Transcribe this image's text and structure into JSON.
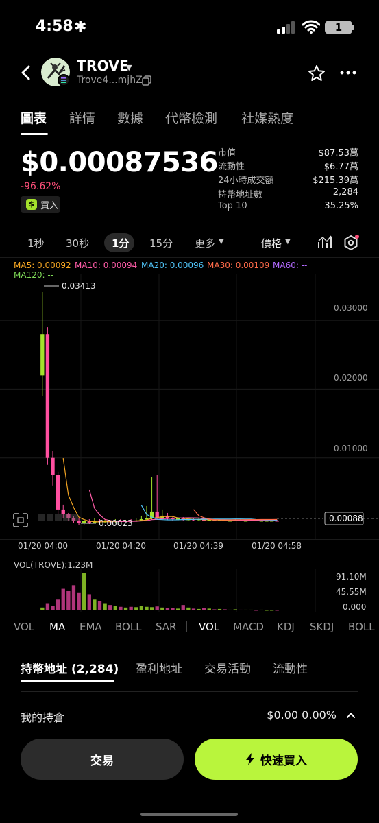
{
  "status": {
    "time": "4:58",
    "battery": "1"
  },
  "header": {
    "name": "TROVE",
    "address": "Trove4...mjhZ"
  },
  "tabs": [
    "圖表",
    "詳情",
    "數據",
    "代幣檢測",
    "社媒熱度"
  ],
  "price": {
    "value": "$0.00087536",
    "change": "-96.62%",
    "buy_label": "買入"
  },
  "stats": [
    {
      "label": "市值",
      "value": "$87.53萬"
    },
    {
      "label": "流動性",
      "value": "$6.77萬"
    },
    {
      "label": "24小時成交額",
      "value": "$215.39萬"
    },
    {
      "label": "持幣地址數",
      "value": "2,284"
    },
    {
      "label": "Top 10",
      "value": "35.25%"
    }
  ],
  "intervals": [
    "1秒",
    "30秒",
    "1分",
    "15分",
    "更多"
  ],
  "price_selector": "價格",
  "ma_legend": [
    {
      "label": "MA5: 0.00092",
      "color": "#f5a623"
    },
    {
      "label": "MA10: 0.00094",
      "color": "#ff5ca8"
    },
    {
      "label": "MA20: 0.00096",
      "color": "#4fc3f7"
    },
    {
      "label": "MA30: 0.00109",
      "color": "#ff6b4a"
    },
    {
      "label": "MA60: --",
      "color": "#b36bff"
    },
    {
      "label": "MA120: --",
      "color": "#7ed957"
    }
  ],
  "colors": {
    "up": "#a4e22c",
    "down": "#ff4fa0",
    "accent": "#b9f53c"
  },
  "chart_data": {
    "type": "candlestick",
    "y_ticks": [
      "0.03000",
      "0.02000",
      "0.01000"
    ],
    "x_ticks": [
      "01/20 04:00",
      "01/20 04:20",
      "01/20 04:39",
      "01/20 04:58"
    ],
    "high_label": "0.03413",
    "low_label": "0.00023",
    "last_price": "0.00088",
    "ylim": [
      0,
      0.035
    ],
    "candles": [
      [
        0.022,
        0.028,
        0.0341,
        0.019
      ],
      [
        0.028,
        0.01,
        0.029,
        0.009
      ],
      [
        0.01,
        0.0075,
        0.011,
        0.006
      ],
      [
        0.0075,
        0.0025,
        0.008,
        0.0018
      ],
      [
        0.0025,
        0.0018,
        0.0032,
        0.0012
      ],
      [
        0.0018,
        0.0012,
        0.002,
        0.0008
      ],
      [
        0.0012,
        0.0009,
        0.0015,
        0.0006
      ],
      [
        0.0009,
        0.0005,
        0.0012,
        0.0003
      ],
      [
        0.0005,
        0.0008,
        0.001,
        0.00023
      ],
      [
        0.0008,
        0.0006,
        0.0011,
        0.0004
      ],
      [
        0.0006,
        0.0009,
        0.0012,
        0.0005
      ],
      [
        0.0009,
        0.0007,
        0.0011,
        0.0005
      ],
      [
        0.0007,
        0.0008,
        0.001,
        0.0005
      ],
      [
        0.0008,
        0.0007,
        0.001,
        0.0006
      ],
      [
        0.0007,
        0.0009,
        0.0011,
        0.0006
      ],
      [
        0.0009,
        0.0008,
        0.0011,
        0.0007
      ],
      [
        0.0008,
        0.0009,
        0.001,
        0.0007
      ],
      [
        0.0009,
        0.0008,
        0.0011,
        0.0007
      ],
      [
        0.0008,
        0.0009,
        0.0012,
        0.0007
      ],
      [
        0.0009,
        0.0011,
        0.0016,
        0.0008
      ],
      [
        0.0011,
        0.0012,
        0.003,
        0.0009
      ],
      [
        0.0012,
        0.0022,
        0.0072,
        0.001
      ],
      [
        0.0022,
        0.0012,
        0.0075,
        0.001
      ],
      [
        0.0012,
        0.0016,
        0.0025,
        0.001
      ],
      [
        0.0016,
        0.0013,
        0.002,
        0.001
      ],
      [
        0.0013,
        0.0011,
        0.0016,
        0.0009
      ],
      [
        0.0011,
        0.0012,
        0.0014,
        0.0009
      ],
      [
        0.0012,
        0.001,
        0.0014,
        0.0009
      ],
      [
        0.001,
        0.0011,
        0.0013,
        0.0009
      ],
      [
        0.0011,
        0.001,
        0.0012,
        0.0009
      ],
      [
        0.001,
        0.0011,
        0.0012,
        0.0009
      ],
      [
        0.0011,
        0.0009,
        0.0012,
        0.0008
      ],
      [
        0.0009,
        0.001,
        0.0011,
        0.0008
      ],
      [
        0.001,
        0.0009,
        0.0011,
        0.0008
      ],
      [
        0.0009,
        0.001,
        0.0011,
        0.0008
      ],
      [
        0.001,
        0.0009,
        0.0011,
        0.0008
      ],
      [
        0.0009,
        0.0009,
        0.001,
        0.0008
      ],
      [
        0.0009,
        0.001,
        0.0011,
        0.0008
      ],
      [
        0.001,
        0.0009,
        0.0011,
        0.0008
      ],
      [
        0.0009,
        0.0009,
        0.001,
        0.0008
      ],
      [
        0.0009,
        0.001,
        0.0011,
        0.0008
      ],
      [
        0.001,
        0.0009,
        0.001,
        0.0008
      ],
      [
        0.0009,
        0.0009,
        0.001,
        0.0008
      ],
      [
        0.0009,
        0.0009,
        0.001,
        0.0008
      ],
      [
        0.0009,
        0.0009,
        0.001,
        0.0008
      ],
      [
        0.0009,
        0.00088,
        0.001,
        0.0008
      ]
    ]
  },
  "volume": {
    "title": "VOL(TROVE):1.23M",
    "y_ticks": [
      "91.10M",
      "45.55M",
      "0.000"
    ],
    "values": [
      8,
      20,
      12,
      30,
      60,
      55,
      70,
      50,
      105,
      45,
      30,
      25,
      20,
      15,
      12,
      10,
      8,
      10,
      9,
      12,
      10,
      9,
      11,
      8,
      6,
      7,
      5,
      15,
      8,
      5,
      4,
      6,
      5,
      3,
      4,
      3,
      2,
      3,
      2,
      2,
      2,
      1,
      2,
      1,
      1,
      1
    ]
  },
  "indicators": [
    "VOL",
    "MA",
    "EMA",
    "BOLL",
    "SAR",
    "VOL",
    "MACD",
    "KDJ",
    "SKDJ",
    "BOLL"
  ],
  "bottom_tabs": [
    "持幣地址 (2,284)",
    "盈利地址",
    "交易活動",
    "流動性"
  ],
  "holding": {
    "label": "我的持倉",
    "value": "$0.00 0.00%"
  },
  "buttons": {
    "trade": "交易",
    "fast_buy": "快速買入"
  }
}
